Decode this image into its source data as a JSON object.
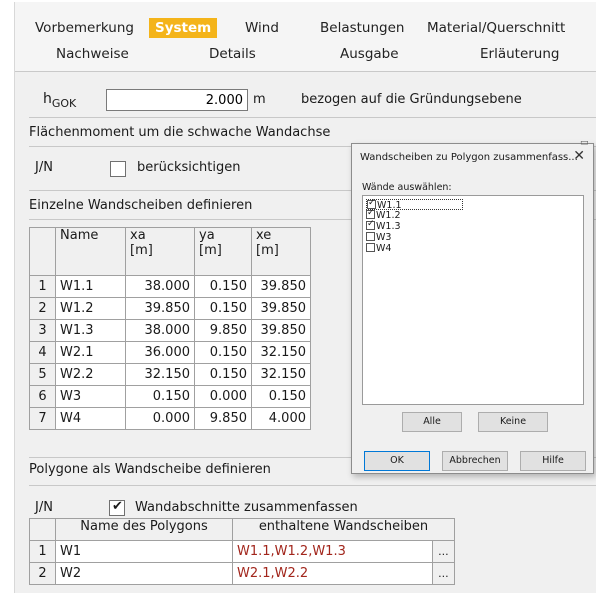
{
  "tabs": {
    "row1": [
      "Vorbemerkung",
      "System",
      "Wind",
      "Belastungen",
      "Material/Querschnitt"
    ],
    "row2": [
      "Nachweise",
      "Details",
      "Ausgabe",
      "Erläuterung"
    ],
    "active": "System"
  },
  "hgok": {
    "label_main": "h",
    "label_sub": "GOK",
    "value": "2.000",
    "unit": "m",
    "note": "bezogen auf die Gründungsebene"
  },
  "flaechenmoment": {
    "title": "Flächenmoment um die schwache Wandachse",
    "jn_label": "J/N",
    "checkbox_label": "berücksichtigen",
    "checked": false
  },
  "wandscheiben": {
    "title": "Einzelne Wandscheiben definieren",
    "headers": [
      {
        "top": "Name",
        "bottom": ""
      },
      {
        "top": "xa",
        "bottom": "[m]"
      },
      {
        "top": "ya",
        "bottom": "[m]"
      },
      {
        "top": "xe",
        "bottom": "[m]"
      }
    ],
    "rows": [
      {
        "n": "1",
        "name": "W1.1",
        "xa": "38.000",
        "ya": "0.150",
        "xe": "39.850"
      },
      {
        "n": "2",
        "name": "W1.2",
        "xa": "39.850",
        "ya": "0.150",
        "xe": "39.850"
      },
      {
        "n": "3",
        "name": "W1.3",
        "xa": "38.000",
        "ya": "9.850",
        "xe": "39.850"
      },
      {
        "n": "4",
        "name": "W2.1",
        "xa": "36.000",
        "ya": "0.150",
        "xe": "32.150"
      },
      {
        "n": "5",
        "name": "W2.2",
        "xa": "32.150",
        "ya": "0.150",
        "xe": "32.150"
      },
      {
        "n": "6",
        "name": "W3",
        "xa": "0.150",
        "ya": "0.000",
        "xe": "0.150"
      },
      {
        "n": "7",
        "name": "W4",
        "xa": "0.000",
        "ya": "9.850",
        "xe": "4.000"
      }
    ]
  },
  "polygone": {
    "title": "Polygone als Wandscheibe definieren",
    "jn_label": "J/N",
    "checkbox_label": "Wandabschnitte zusammenfassen",
    "checked": true,
    "headers": [
      "Name des Polygons",
      "enthaltene Wandscheiben"
    ],
    "rows": [
      {
        "n": "1",
        "name": "W1",
        "walls": "W1.1,W1.2,W1.3",
        "button": "..."
      },
      {
        "n": "2",
        "name": "W2",
        "walls": "W2.1,W2.2",
        "button": "..."
      }
    ]
  },
  "dialog": {
    "title": "Wandscheiben zu Polygon zusammenfass...",
    "close": "✕",
    "list_label": "Wände auswählen:",
    "items": [
      {
        "label": "W1.1",
        "checked": true
      },
      {
        "label": "W1.2",
        "checked": true
      },
      {
        "label": "W1.3",
        "checked": true
      },
      {
        "label": "W3",
        "checked": false
      },
      {
        "label": "W4",
        "checked": false
      }
    ],
    "buttons": {
      "alle": "Alle",
      "keine": "Keine",
      "ok": "OK",
      "abbrechen": "Abbrechen",
      "hilfe": "Hilfe"
    }
  },
  "colors": {
    "active_tab": "#f4b41a",
    "link_red": "#a2261c",
    "dialog_default_border": "#0078d7"
  }
}
